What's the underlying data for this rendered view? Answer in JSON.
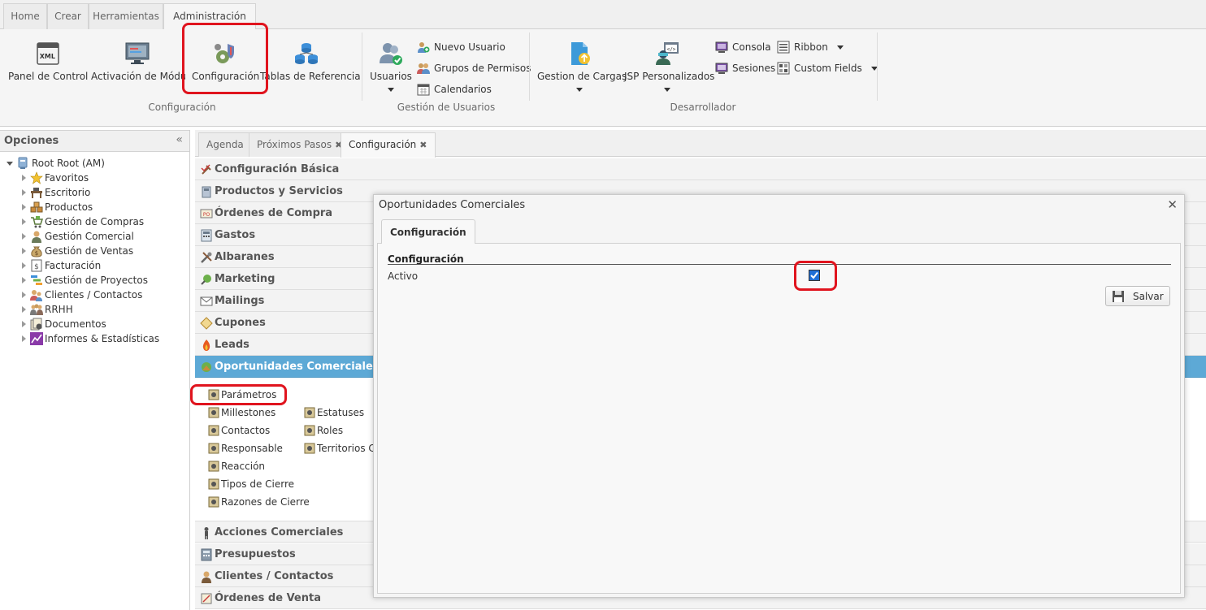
{
  "ribbon_tabs": [
    "Home",
    "Crear",
    "Herramientas",
    "Administración"
  ],
  "ribbon": {
    "config_group": {
      "name": "Configuración",
      "buttons": [
        "Panel de Control",
        "Activación de Módulos",
        "Configuración",
        "Tablas de Referencia"
      ]
    },
    "users_group": {
      "name": "Gestión de Usuarios",
      "big_button": "Usuarios",
      "small_buttons": [
        "Nuevo Usuario",
        "Grupos de Permisos",
        "Calendarios"
      ]
    },
    "dev_group": {
      "name": "Desarrollador",
      "big_buttons": [
        "Gestion de Cargas",
        "JSP Personalizados"
      ],
      "small_buttons": [
        "Consola",
        "Sesiones",
        "Ribbon",
        "Custom Fields"
      ]
    }
  },
  "left_panel": {
    "title": "Opciones",
    "root": "Root Root (AM)",
    "items": [
      "Favoritos",
      "Escritorio",
      "Productos",
      "Gestión de Compras",
      "Gestión Comercial",
      "Gestión de Ventas",
      "Facturación",
      "Gestión de Proyectos",
      "Clientes / Contactos",
      "RRHH",
      "Documentos",
      "Informes & Estadísticas"
    ]
  },
  "content_tabs": [
    "Agenda",
    "Próximos Pasos",
    "Configuración"
  ],
  "accordion": {
    "top": [
      "Configuración Básica",
      "Productos y Servicios",
      "Órdenes de Compra",
      "Gastos",
      "Albaranes",
      "Marketing",
      "Mailings",
      "Cupones",
      "Leads"
    ],
    "active": "Oportunidades Comerciales",
    "sub_col1": [
      "Parámetros",
      "Millestones",
      "Contactos",
      "Responsable",
      "Reacción",
      "Tipos de Cierre",
      "Razones de Cierre"
    ],
    "sub_col2": [
      "Estatuses",
      "Roles",
      "Territorios Co"
    ],
    "bottom": [
      "Acciones Comerciales",
      "Presupuestos",
      "Clientes / Contactos",
      "Órdenes de Venta"
    ]
  },
  "dialog": {
    "title": "Oportunidades Comerciales",
    "tab": "Configuración",
    "section": "Configuración",
    "field_label": "Activo",
    "field_checked": true,
    "save_label": "Salvar"
  },
  "colors": {
    "accent_active_row": "#5da9d6",
    "highlight_red": "#e0141e",
    "checkbox_blue": "#1f6fd6"
  }
}
